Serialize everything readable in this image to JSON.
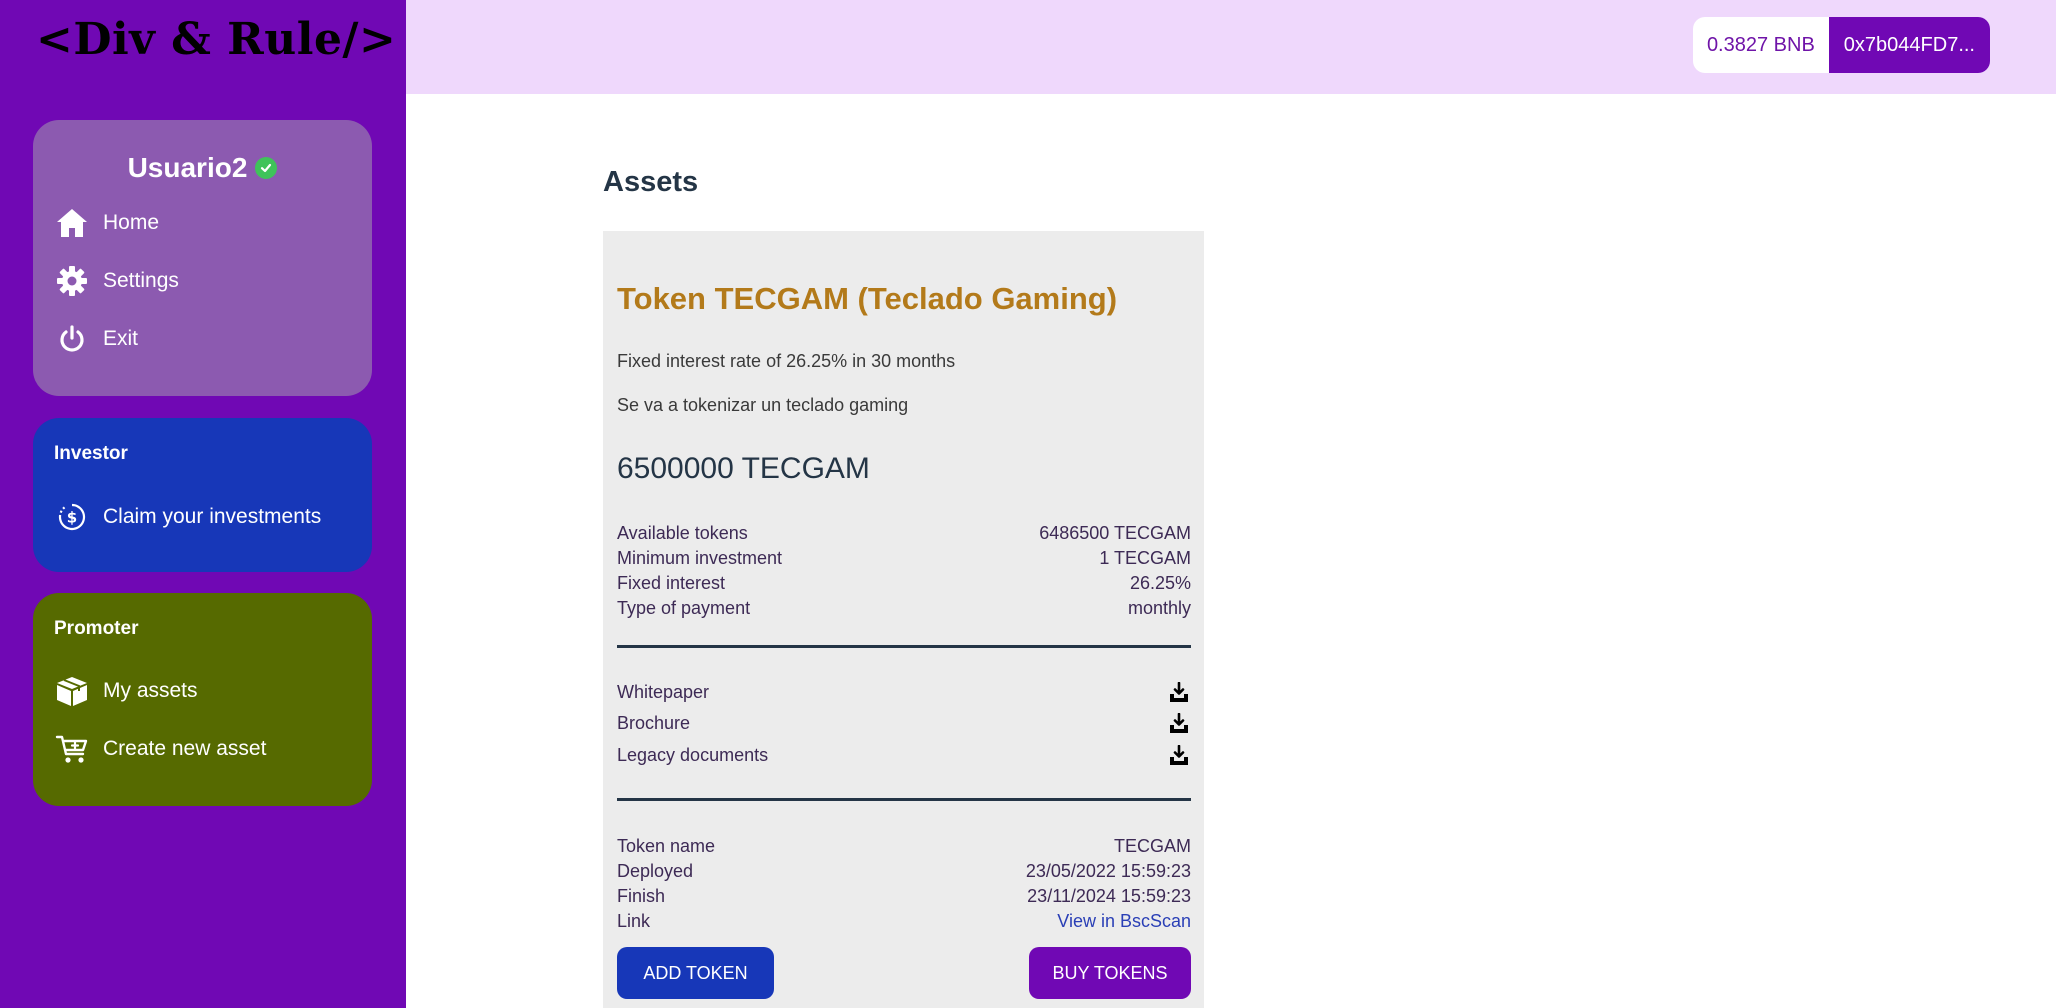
{
  "sidebar": {
    "logo": "<Div & Rule/>",
    "user": {
      "name": "Usuario2",
      "items": [
        {
          "label": "Home",
          "icon": "home-icon"
        },
        {
          "label": "Settings",
          "icon": "gear-icon"
        },
        {
          "label": "Exit",
          "icon": "power-icon"
        }
      ]
    },
    "investor": {
      "title": "Investor",
      "items": [
        {
          "label": "Claim your investments",
          "icon": "dollar-cycle-icon"
        }
      ]
    },
    "promoter": {
      "title": "Promoter",
      "items": [
        {
          "label": "My assets",
          "icon": "box-icon"
        },
        {
          "label": "Create new asset",
          "icon": "cart-plus-icon"
        }
      ]
    }
  },
  "topbar": {
    "balance": "0.3827 BNB",
    "address": "0x7b044FD7..."
  },
  "main": {
    "title": "Assets",
    "asset": {
      "title": "Token TECGAM (Teclado Gaming)",
      "interest_text": "Fixed interest rate of 26.25% in 30 months",
      "description": "Se va a tokenizar un teclado gaming",
      "total": "6500000 TECGAM",
      "details": [
        {
          "label": "Available tokens",
          "value": "6486500 TECGAM"
        },
        {
          "label": "Minimum investment",
          "value": "1 TECGAM"
        },
        {
          "label": "Fixed interest",
          "value": "26.25%"
        },
        {
          "label": "Type of payment",
          "value": "monthly"
        }
      ],
      "documents": [
        {
          "label": "Whitepaper",
          "icon": "download-icon"
        },
        {
          "label": "Brochure",
          "icon": "download-icon"
        },
        {
          "label": "Legacy documents",
          "icon": "download-icon"
        }
      ],
      "token_info": [
        {
          "label": "Token name",
          "value": "TECGAM"
        },
        {
          "label": "Deployed",
          "value": "23/05/2022 15:59:23"
        },
        {
          "label": "Finish",
          "value": "23/11/2024 15:59:23"
        },
        {
          "label": "Link",
          "value": "View in BscScan"
        }
      ],
      "add_button": "ADD TOKEN",
      "buy_button": "BUY TOKENS"
    }
  },
  "colors": {
    "sidebar": "#7008b4",
    "user_card": "#8c5ab0",
    "investor_card": "#1737b8",
    "promoter_card": "#566a00",
    "topbar": "#efd8fc",
    "asset_title": "#b37a1a"
  }
}
